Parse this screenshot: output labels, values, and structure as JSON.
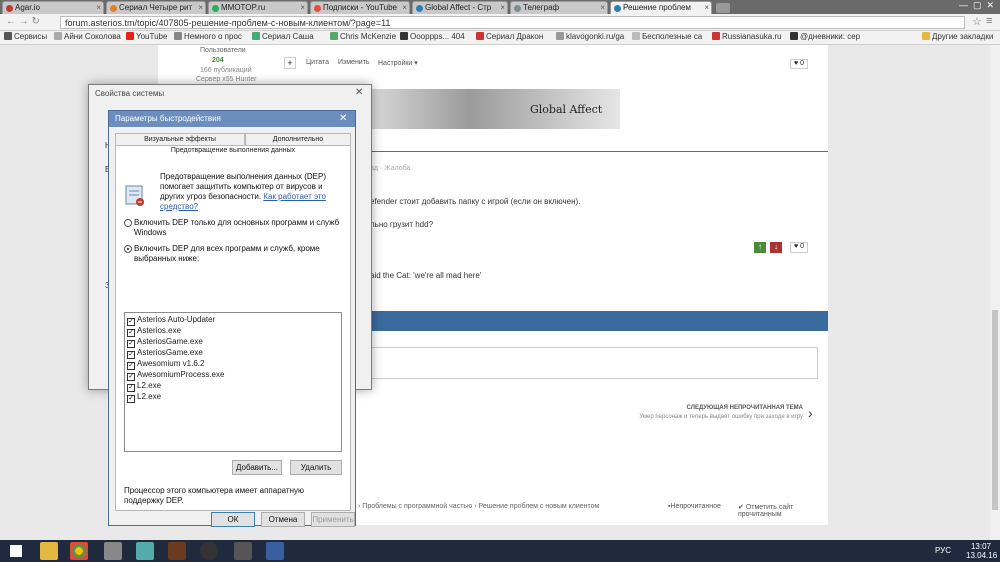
{
  "tabs": [
    {
      "title": "Agar.io",
      "color": "#c0392b"
    },
    {
      "title": "Сериал Четыре рит",
      "color": "#e67e22"
    },
    {
      "title": "MMOTOP.ru",
      "color": "#27ae60"
    },
    {
      "title": "Подписки - YouTube",
      "color": "#e74c3c"
    },
    {
      "title": "Global Affect - Стр",
      "color": "#2980b9"
    },
    {
      "title": "Телеграф",
      "color": "#7f8c8d"
    },
    {
      "title": "Решение проблем",
      "color": "#2980b9"
    }
  ],
  "address": {
    "url": "forum.asterios.tm/topic/407805-решение-проблем-с-новым-клиентом/?page=11"
  },
  "bookmarks": {
    "apps": "Сервисы",
    "items": [
      "Айни Соколова",
      "YouTube",
      "Немного о прос",
      "Сериал Саша",
      "Chris McKenzie",
      "Oooppps... 404",
      "Сериал Дракон",
      "klavogonki.ru/ga",
      "Бесполезные са",
      "Russianasuka.ru",
      "@дневники: сер"
    ],
    "other": "Другие закладки"
  },
  "forum": {
    "users_label": "Пользователи",
    "rep": "204",
    "posts": "166 публикаций",
    "server": "Сервер x55 Hunter",
    "quote": "Цитата",
    "edit": "Изменить",
    "settings": "Настройки",
    "like_count": "0",
    "banner": "Global Affect",
    "complaint": "ад · Жалоба",
    "defender_text": "efender стоит добавить папку с игрой (если он включен).",
    "hdd_text": "льно грузит hdd?",
    "cat_text": "aid the Cat: 'we're all mad here'",
    "next_topic_label": "СЛЕДУЮЩАЯ НЕПРОЧИТАННАЯ ТЕМА",
    "next_topic_title": "Умер персонаж и теперь выдает ошибку при заходе в игру",
    "breadcrumb_1": "Проблемы с программной частью",
    "breadcrumb_2": "Решение проблем с новым клиентом",
    "unread": "Непрочитанное",
    "mark_read": "Отметить сайт прочитанным"
  },
  "sysprops": {
    "title": "Свойства системы"
  },
  "perf": {
    "title": "Параметры быстродействия",
    "tab1": "Визуальные эффекты",
    "tab2": "Дополнительно",
    "tab3": "Предотвращение выполнения данных",
    "desc": "Предотвращение выполнения данных (DEP) помогает защитить компьютер от вирусов и других угроз безопасности.",
    "link": "Как работает это средство?",
    "opt1": "Включить DEP только для основных программ и служб Windows",
    "opt2": "Включить DEP для всех программ и служб, кроме выбранных ниже:",
    "programs": [
      "Asterios Auto-Updater",
      "Asterios.exe",
      "AsteriosGame.exe",
      "AsteriosGame.exe",
      "Awesomium v1.6.2",
      "AwesomiumProcess.exe",
      "L2.exe",
      "L2.exe"
    ],
    "add": "Добавить...",
    "remove": "Удалить",
    "hw_note": "Процессор этого компьютера имеет аппаратную поддержку DEP.",
    "ok": "ОК",
    "cancel": "Отмена",
    "apply": "Применить"
  },
  "taskbar": {
    "lang": "РУС",
    "time": "13:07",
    "date": "13.04.16"
  }
}
